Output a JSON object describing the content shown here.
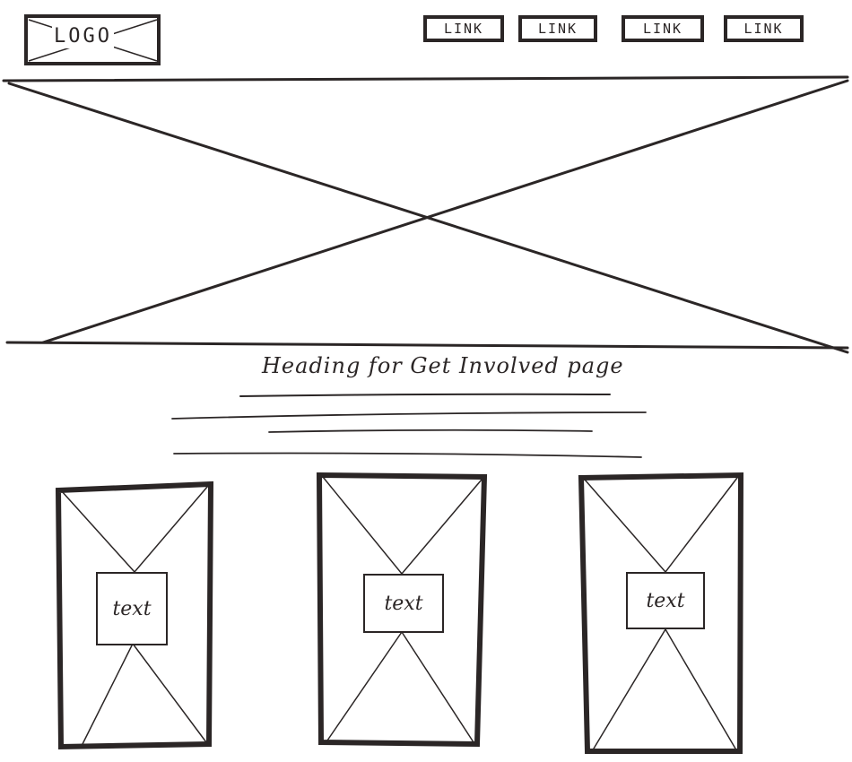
{
  "header": {
    "logo_label": "LOGO",
    "nav_links": [
      {
        "label": "LINK"
      },
      {
        "label": "LINK"
      },
      {
        "label": "LINK"
      },
      {
        "label": "LINK"
      }
    ]
  },
  "main": {
    "heading": "Heading for Get Involved page",
    "cards": [
      {
        "label": "text"
      },
      {
        "label": "text"
      },
      {
        "label": "text"
      }
    ]
  },
  "colors": {
    "ink": "#2b2626",
    "paper": "#ffffff"
  }
}
